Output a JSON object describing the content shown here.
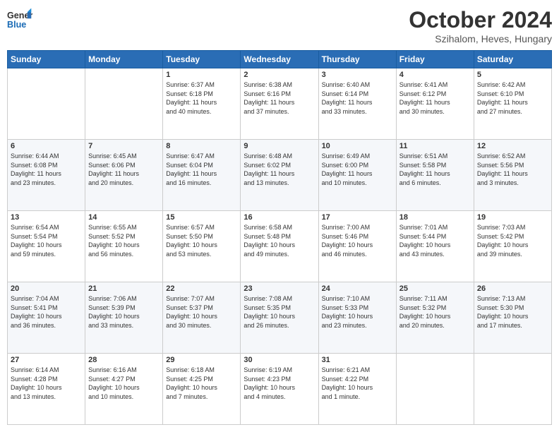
{
  "header": {
    "logo_line1": "General",
    "logo_line2": "Blue",
    "month_title": "October 2024",
    "location": "Szihalom, Heves, Hungary"
  },
  "days_of_week": [
    "Sunday",
    "Monday",
    "Tuesday",
    "Wednesday",
    "Thursday",
    "Friday",
    "Saturday"
  ],
  "weeks": [
    [
      {
        "day": "",
        "info": ""
      },
      {
        "day": "",
        "info": ""
      },
      {
        "day": "1",
        "info": "Sunrise: 6:37 AM\nSunset: 6:18 PM\nDaylight: 11 hours\nand 40 minutes."
      },
      {
        "day": "2",
        "info": "Sunrise: 6:38 AM\nSunset: 6:16 PM\nDaylight: 11 hours\nand 37 minutes."
      },
      {
        "day": "3",
        "info": "Sunrise: 6:40 AM\nSunset: 6:14 PM\nDaylight: 11 hours\nand 33 minutes."
      },
      {
        "day": "4",
        "info": "Sunrise: 6:41 AM\nSunset: 6:12 PM\nDaylight: 11 hours\nand 30 minutes."
      },
      {
        "day": "5",
        "info": "Sunrise: 6:42 AM\nSunset: 6:10 PM\nDaylight: 11 hours\nand 27 minutes."
      }
    ],
    [
      {
        "day": "6",
        "info": "Sunrise: 6:44 AM\nSunset: 6:08 PM\nDaylight: 11 hours\nand 23 minutes."
      },
      {
        "day": "7",
        "info": "Sunrise: 6:45 AM\nSunset: 6:06 PM\nDaylight: 11 hours\nand 20 minutes."
      },
      {
        "day": "8",
        "info": "Sunrise: 6:47 AM\nSunset: 6:04 PM\nDaylight: 11 hours\nand 16 minutes."
      },
      {
        "day": "9",
        "info": "Sunrise: 6:48 AM\nSunset: 6:02 PM\nDaylight: 11 hours\nand 13 minutes."
      },
      {
        "day": "10",
        "info": "Sunrise: 6:49 AM\nSunset: 6:00 PM\nDaylight: 11 hours\nand 10 minutes."
      },
      {
        "day": "11",
        "info": "Sunrise: 6:51 AM\nSunset: 5:58 PM\nDaylight: 11 hours\nand 6 minutes."
      },
      {
        "day": "12",
        "info": "Sunrise: 6:52 AM\nSunset: 5:56 PM\nDaylight: 11 hours\nand 3 minutes."
      }
    ],
    [
      {
        "day": "13",
        "info": "Sunrise: 6:54 AM\nSunset: 5:54 PM\nDaylight: 10 hours\nand 59 minutes."
      },
      {
        "day": "14",
        "info": "Sunrise: 6:55 AM\nSunset: 5:52 PM\nDaylight: 10 hours\nand 56 minutes."
      },
      {
        "day": "15",
        "info": "Sunrise: 6:57 AM\nSunset: 5:50 PM\nDaylight: 10 hours\nand 53 minutes."
      },
      {
        "day": "16",
        "info": "Sunrise: 6:58 AM\nSunset: 5:48 PM\nDaylight: 10 hours\nand 49 minutes."
      },
      {
        "day": "17",
        "info": "Sunrise: 7:00 AM\nSunset: 5:46 PM\nDaylight: 10 hours\nand 46 minutes."
      },
      {
        "day": "18",
        "info": "Sunrise: 7:01 AM\nSunset: 5:44 PM\nDaylight: 10 hours\nand 43 minutes."
      },
      {
        "day": "19",
        "info": "Sunrise: 7:03 AM\nSunset: 5:42 PM\nDaylight: 10 hours\nand 39 minutes."
      }
    ],
    [
      {
        "day": "20",
        "info": "Sunrise: 7:04 AM\nSunset: 5:41 PM\nDaylight: 10 hours\nand 36 minutes."
      },
      {
        "day": "21",
        "info": "Sunrise: 7:06 AM\nSunset: 5:39 PM\nDaylight: 10 hours\nand 33 minutes."
      },
      {
        "day": "22",
        "info": "Sunrise: 7:07 AM\nSunset: 5:37 PM\nDaylight: 10 hours\nand 30 minutes."
      },
      {
        "day": "23",
        "info": "Sunrise: 7:08 AM\nSunset: 5:35 PM\nDaylight: 10 hours\nand 26 minutes."
      },
      {
        "day": "24",
        "info": "Sunrise: 7:10 AM\nSunset: 5:33 PM\nDaylight: 10 hours\nand 23 minutes."
      },
      {
        "day": "25",
        "info": "Sunrise: 7:11 AM\nSunset: 5:32 PM\nDaylight: 10 hours\nand 20 minutes."
      },
      {
        "day": "26",
        "info": "Sunrise: 7:13 AM\nSunset: 5:30 PM\nDaylight: 10 hours\nand 17 minutes."
      }
    ],
    [
      {
        "day": "27",
        "info": "Sunrise: 6:14 AM\nSunset: 4:28 PM\nDaylight: 10 hours\nand 13 minutes."
      },
      {
        "day": "28",
        "info": "Sunrise: 6:16 AM\nSunset: 4:27 PM\nDaylight: 10 hours\nand 10 minutes."
      },
      {
        "day": "29",
        "info": "Sunrise: 6:18 AM\nSunset: 4:25 PM\nDaylight: 10 hours\nand 7 minutes."
      },
      {
        "day": "30",
        "info": "Sunrise: 6:19 AM\nSunset: 4:23 PM\nDaylight: 10 hours\nand 4 minutes."
      },
      {
        "day": "31",
        "info": "Sunrise: 6:21 AM\nSunset: 4:22 PM\nDaylight: 10 hours\nand 1 minute."
      },
      {
        "day": "",
        "info": ""
      },
      {
        "day": "",
        "info": ""
      }
    ]
  ]
}
